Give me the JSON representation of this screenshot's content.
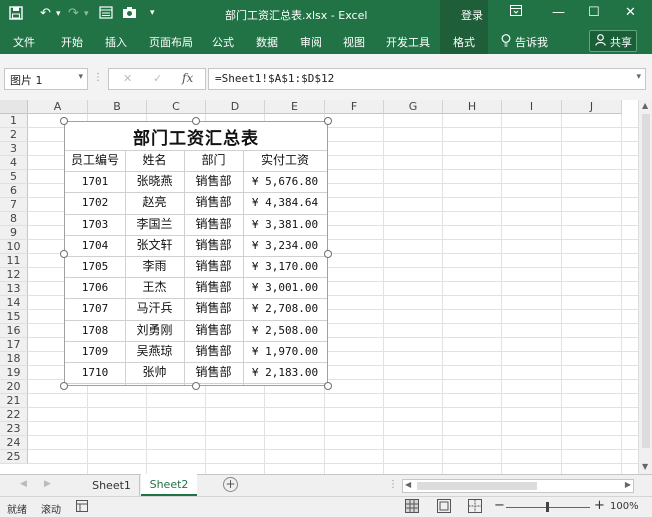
{
  "window": {
    "title": "部门工资汇总表.xlsx - Excel",
    "login": "登录",
    "context_tab_group": "格式"
  },
  "ribbon": {
    "tabs": [
      "文件",
      "开始",
      "插入",
      "页面布局",
      "公式",
      "数据",
      "审阅",
      "视图",
      "开发工具",
      "格式"
    ],
    "tell_me": "告诉我",
    "share": "共享"
  },
  "formula_bar": {
    "name_box": "图片 1",
    "formula": "=Sheet1!$A$1:$D$12"
  },
  "grid": {
    "columns": [
      "A",
      "B",
      "C",
      "D",
      "E",
      "F",
      "G",
      "H",
      "I",
      "J"
    ],
    "rows": [
      "1",
      "2",
      "3",
      "4",
      "5",
      "6",
      "7",
      "8",
      "9",
      "10",
      "11",
      "12",
      "13",
      "14",
      "15",
      "16",
      "17",
      "18",
      "19",
      "20",
      "21",
      "22",
      "23",
      "24",
      "25"
    ]
  },
  "picture": {
    "title": "部门工资汇总表",
    "headers": [
      "员工编号",
      "姓名",
      "部门",
      "实付工资"
    ],
    "records": [
      [
        "1701",
        "张晓燕",
        "销售部",
        "¥ 5,676.80"
      ],
      [
        "1702",
        "赵亮",
        "销售部",
        "¥ 4,384.64"
      ],
      [
        "1703",
        "李国兰",
        "销售部",
        "¥ 3,381.00"
      ],
      [
        "1704",
        "张文轩",
        "销售部",
        "¥ 3,234.00"
      ],
      [
        "1705",
        "李雨",
        "销售部",
        "¥ 3,170.00"
      ],
      [
        "1706",
        "王杰",
        "销售部",
        "¥ 3,001.00"
      ],
      [
        "1707",
        "马汗兵",
        "销售部",
        "¥ 2,708.00"
      ],
      [
        "1708",
        "刘勇刚",
        "销售部",
        "¥ 2,508.00"
      ],
      [
        "1709",
        "吴燕琼",
        "销售部",
        "¥ 1,970.00"
      ],
      [
        "1710",
        "张帅",
        "销售部",
        "¥ 2,183.00"
      ]
    ]
  },
  "sheets": {
    "tabs": [
      "Sheet1",
      "Sheet2"
    ],
    "active": "Sheet2",
    "add_symbol": "+"
  },
  "status": {
    "mode": "就绪",
    "scroll": "滚动",
    "zoom": "100%"
  },
  "colors": {
    "excel_green": "#217346",
    "context_tab": "#1e5e38"
  },
  "icons": [
    "save-icon",
    "undo-icon",
    "redo-icon",
    "form-icon",
    "camera-icon",
    "customize-qat-icon",
    "ribbon-display-icon",
    "minimize-icon",
    "maximize-icon",
    "close-icon",
    "lightbulb-icon",
    "user-icon",
    "cancel-icon",
    "enter-icon",
    "fx-icon",
    "add-sheet-icon",
    "macro-icon",
    "normal-view-icon",
    "page-layout-icon",
    "page-break-icon",
    "zoom-out-icon",
    "zoom-in-icon"
  ]
}
